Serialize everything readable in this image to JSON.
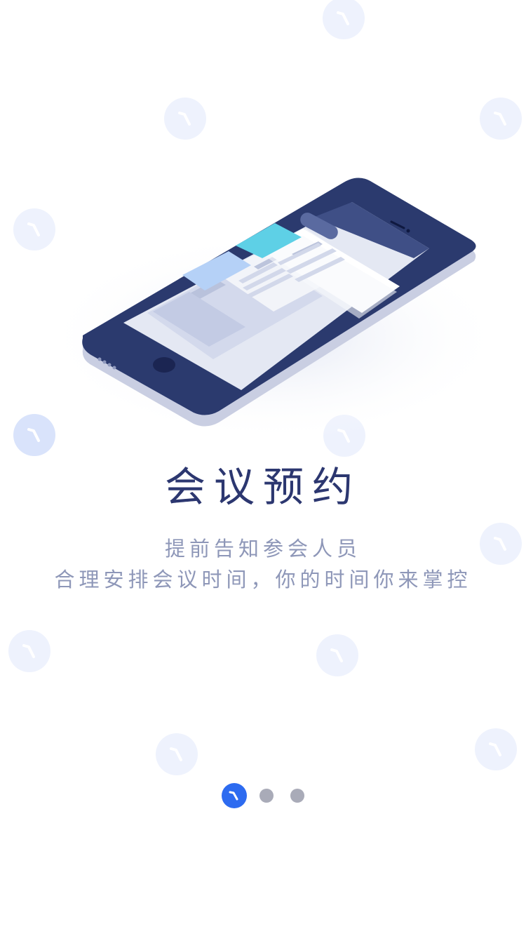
{
  "onboarding": {
    "title": "会议预约",
    "subtitle_line1": "提前告知参会人员",
    "subtitle_line2": "合理安排会议时间，你的时间你来掌控"
  },
  "pager": {
    "page_count": 3,
    "active_index": 0
  },
  "colors": {
    "accent": "#2d6bf0",
    "title": "#2c3770",
    "subtitle": "#8e97b8",
    "phone_body": "#2b3a6e",
    "dot_inactive": "#a9abb8",
    "bg_clock": "#eef2fd"
  },
  "icons": {
    "background": "clock-icon",
    "pager_active": "clock-icon",
    "illustration": "phone-illustration"
  }
}
